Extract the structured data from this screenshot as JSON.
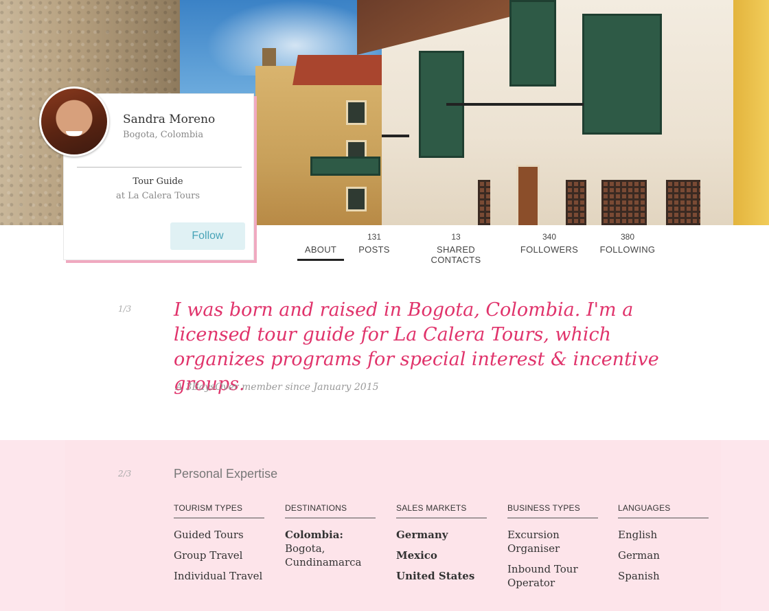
{
  "profile": {
    "name": "Sandra Moreno",
    "location": "Bogota, Colombia",
    "role": "Tour Guide",
    "company": "at La Calera Tours",
    "follow_label": "Follow"
  },
  "tabs": [
    {
      "label": "ABOUT",
      "count": ""
    },
    {
      "label": "POSTS",
      "count": "131"
    },
    {
      "label": "SHARED CONTACTS",
      "count": "13"
    },
    {
      "label": "FOLLOWERS",
      "count": "340"
    },
    {
      "label": "FOLLOWING",
      "count": "380"
    }
  ],
  "about": {
    "section_number": "1/3",
    "quote": "I was born and raised in Bogota, Colombia. I'm a licensed tour guide for La Calera Tours, which organizes programs for special interest & incentive groups.",
    "member_since": "A 3BaysOver member since January 2015"
  },
  "expertise": {
    "section_number": "2/3",
    "title": "Personal Expertise",
    "columns": [
      {
        "header": "TOURISM TYPES",
        "items": [
          "Guided Tours",
          "Group Travel",
          "Individual Travel"
        ]
      },
      {
        "header": "DESTINATIONS",
        "items": [
          "Colombia:",
          "Bogota,",
          "Cundinamarca"
        ]
      },
      {
        "header": "SALES MARKETS",
        "items": [
          "Germany",
          "Mexico",
          "United States"
        ]
      },
      {
        "header": "BUSINESS TYPES",
        "items": [
          "Excursion",
          "Organiser",
          "Inbound Tour",
          "Operator"
        ]
      },
      {
        "header": "LANGUAGES",
        "items": [
          "English",
          "German",
          "Spanish"
        ]
      }
    ]
  },
  "colors": {
    "accent_pink": "#e0336b",
    "follow_bg": "#e0f1f4",
    "follow_text": "#47a3b7",
    "expertise_bg": "#fde6ec"
  }
}
